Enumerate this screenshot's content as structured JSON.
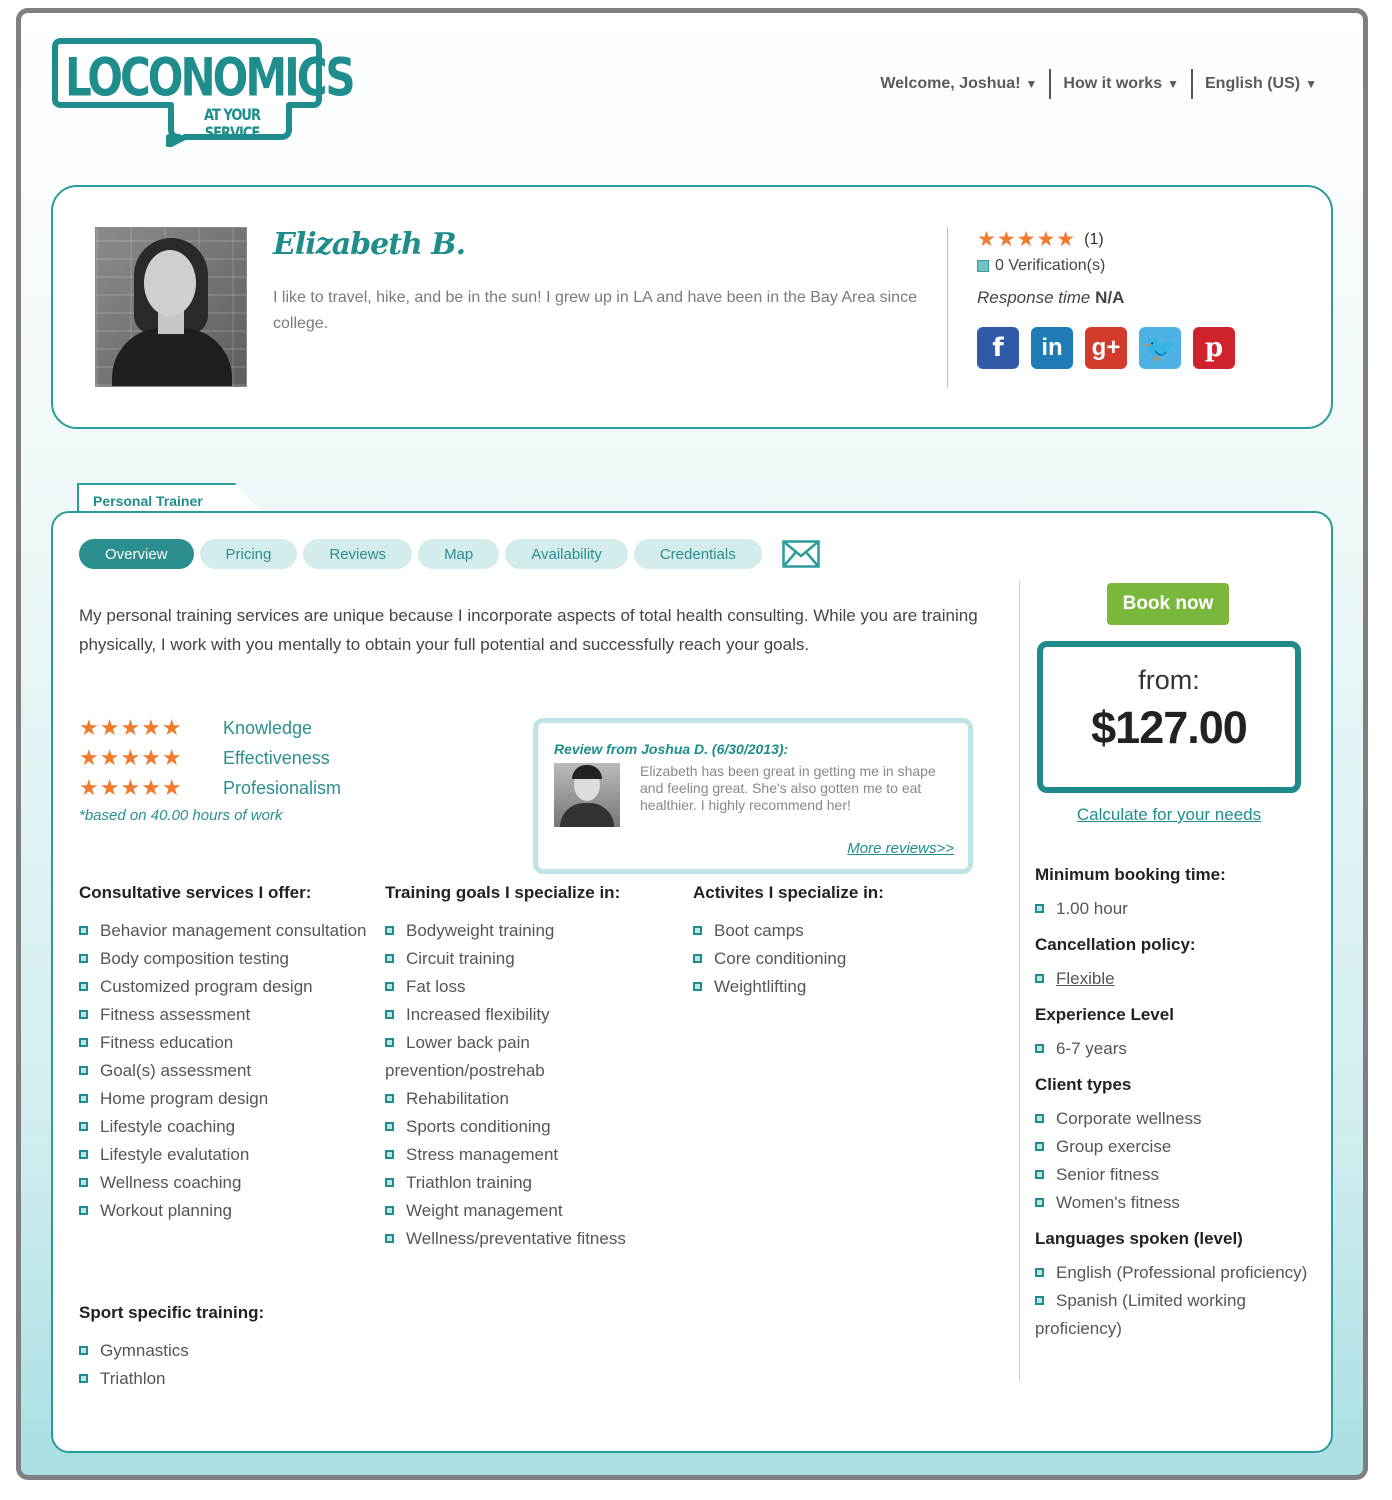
{
  "logo": {
    "name": "LOCONOMICS",
    "tagline": "AT YOUR SERVICE"
  },
  "topnav": [
    {
      "label": "Welcome, Joshua!"
    },
    {
      "label": "How it works"
    },
    {
      "label": "English (US)"
    }
  ],
  "profile": {
    "name": "Elizabeth B.",
    "bio": "I like to travel, hike, and be in the sun! I grew up in LA and have been in the Bay Area since college.",
    "stars": "★★★★★",
    "rating_count": "(1)",
    "verifications": "0 Verification(s)",
    "response_label": "Response time",
    "response_value": "N/A",
    "socials": [
      {
        "name": "facebook",
        "glyph": "f"
      },
      {
        "name": "linkedin",
        "glyph": "in"
      },
      {
        "name": "google-plus",
        "glyph": "g+"
      },
      {
        "name": "twitter",
        "glyph": "🐦"
      },
      {
        "name": "pinterest",
        "glyph": "p"
      }
    ]
  },
  "position_tab": "Personal Trainer",
  "tabs": [
    "Overview",
    "Pricing",
    "Reviews",
    "Map",
    "Availability",
    "Credentials"
  ],
  "overview": "My personal training services are unique because I incorporate aspects of total health consulting. While you are training physically, I work with you mentally to obtain your full potential and successfully reach your goals.",
  "ratings": [
    {
      "label": "Knowledge",
      "stars": "★★★★★"
    },
    {
      "label": "Effectiveness",
      "stars": "★★★★★"
    },
    {
      "label": "Profesionalism",
      "stars": "★★★★★"
    }
  ],
  "ratings_note": "*based on 40.00 hours of work",
  "review": {
    "title": "Review from Joshua D. (6/30/2013):",
    "text": "Elizabeth has been great in getting me in shape and feeling great. She's also gotten me to eat healthier. I highly recommend her!",
    "more": "More reviews>>"
  },
  "consultative": {
    "title": "Consultative services I offer:",
    "items": [
      "Behavior management consultation",
      "Body composition testing",
      "Customized program design",
      "Fitness assessment",
      "Fitness education",
      "Goal(s) assessment",
      "Home program design",
      "Lifestyle coaching",
      "Lifestyle evalutation",
      "Wellness coaching",
      "Workout planning"
    ]
  },
  "training_goals": {
    "title": "Training goals I specialize in:",
    "items": [
      "Bodyweight training",
      "Circuit training",
      "Fat loss",
      "Increased flexibility",
      "Lower back pain prevention/postrehab",
      "Rehabilitation",
      "Sports conditioning",
      "Stress management",
      "Triathlon training",
      "Weight management",
      "Wellness/preventative fitness"
    ]
  },
  "activities": {
    "title": "Activites I specialize in:",
    "items": [
      "Boot camps",
      "Core conditioning",
      "Weightlifting"
    ]
  },
  "sport_specific": {
    "title": "Sport specific training:",
    "items": [
      "Gymnastics",
      "Triathlon"
    ]
  },
  "booking": {
    "book_label": "Book now",
    "from_label": "from:",
    "price": "$127.00",
    "calc_link": "Calculate for your needs"
  },
  "details": [
    {
      "title": "Minimum booking time:",
      "items": [
        "1.00 hour"
      ],
      "link": false
    },
    {
      "title": "Cancellation policy:",
      "items": [
        "Flexible"
      ],
      "link": true
    },
    {
      "title": "Experience Level",
      "items": [
        "6-7 years"
      ],
      "link": false
    },
    {
      "title": "Client types",
      "items": [
        "Corporate wellness",
        "Group exercise",
        "Senior fitness",
        "Women's fitness"
      ],
      "link": false
    },
    {
      "title": "Languages spoken (level)",
      "items": [
        "English (Professional proficiency)",
        "Spanish (Limited working proficiency)"
      ],
      "link": false
    }
  ],
  "colors": {
    "brand": "#1e8d8c",
    "star": "#f07a2e",
    "book": "#7ab83d"
  }
}
